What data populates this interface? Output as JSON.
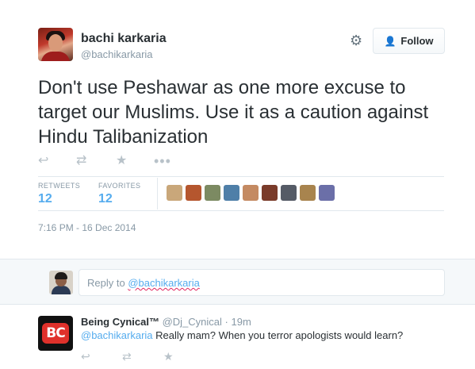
{
  "tweet": {
    "fullname": "bachi karkaria",
    "username": "@bachikarkaria",
    "follow_label": "Follow",
    "text": "Don't use Peshawar as one more excuse to target our Muslims. Use it as a caution against Hindu Talibanization",
    "stats": {
      "retweets_label": "RETWEETS",
      "retweets_value": "12",
      "favorites_label": "FAVORITES",
      "favorites_value": "12"
    },
    "timestamp": "7:16 PM - 16 Dec 2014",
    "favoriters": [
      {
        "color": "#c9a77a"
      },
      {
        "color": "#b5562e"
      },
      {
        "color": "#7c8a62"
      },
      {
        "color": "#4f7fa8"
      },
      {
        "color": "#c48a62"
      },
      {
        "color": "#7a3b2a"
      },
      {
        "color": "#555b66"
      },
      {
        "color": "#a8844e"
      },
      {
        "color": "#6b6fa8"
      }
    ]
  },
  "reply_box": {
    "prefix": "Reply to ",
    "handle": "@bachikarkaria"
  },
  "reply_tweet": {
    "logo_text": "BC",
    "fullname": "Being Cynical™",
    "username": "@Dj_Cynical",
    "time": "19m",
    "mention": "@bachikarkaria",
    "text": " Really mam? When you terror apologists would learn?"
  },
  "colors": {
    "accent": "#55acee",
    "text": "#292f33",
    "muted": "#8899a6"
  }
}
